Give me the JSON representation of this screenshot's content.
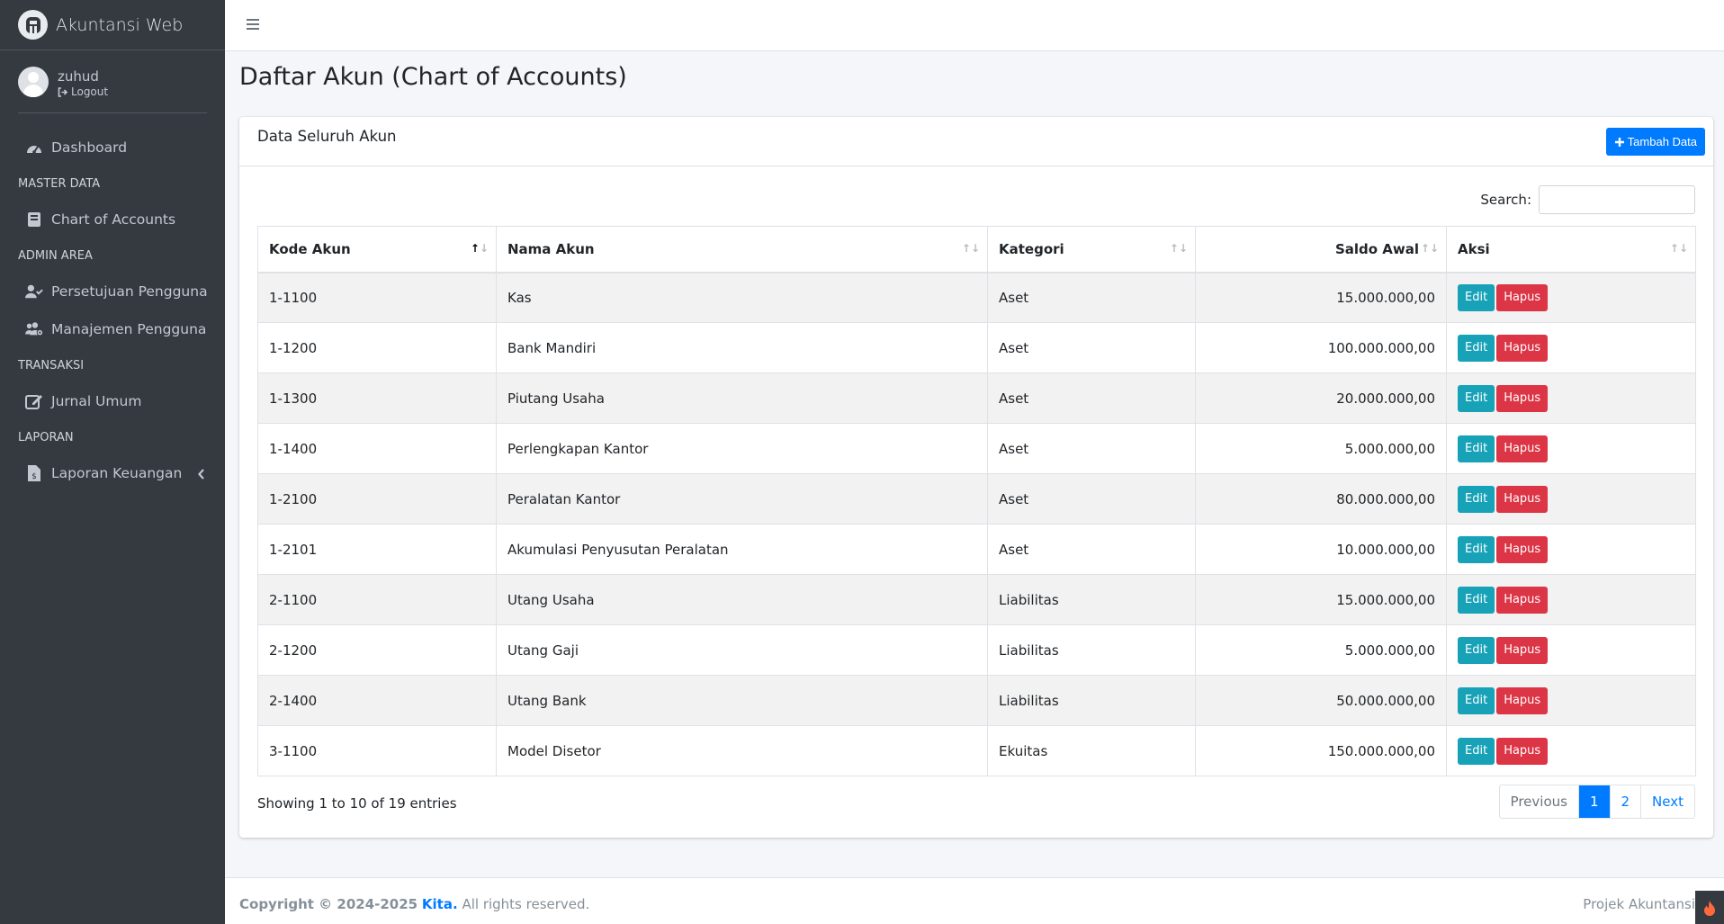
{
  "brand": {
    "name": "Akuntansi Web"
  },
  "user": {
    "name": "zuhud",
    "logout_label": "Logout"
  },
  "sidebar": {
    "dashboard": "Dashboard",
    "header_master": "MASTER DATA",
    "coa": "Chart of Accounts",
    "header_admin": "ADMIN AREA",
    "persetujuan": "Persetujuan Pengguna",
    "manajemen": "Manajemen Pengguna",
    "header_transaksi": "TRANSAKSI",
    "jurnal": "Jurnal Umum",
    "header_laporan": "LAPORAN",
    "laporan": "Laporan Keuangan"
  },
  "page": {
    "title": "Daftar Akun (Chart of Accounts)"
  },
  "card": {
    "title": "Data Seluruh Akun",
    "add_button": "Tambah Data"
  },
  "search": {
    "label": "Search:",
    "value": ""
  },
  "table": {
    "headers": [
      "Kode Akun",
      "Nama Akun",
      "Kategori",
      "Saldo Awal",
      "Aksi"
    ],
    "rows": [
      {
        "kode": "1-1100",
        "nama": "Kas",
        "kategori": "Aset",
        "saldo": "15.000.000,00"
      },
      {
        "kode": "1-1200",
        "nama": "Bank Mandiri",
        "kategori": "Aset",
        "saldo": "100.000.000,00"
      },
      {
        "kode": "1-1300",
        "nama": "Piutang Usaha",
        "kategori": "Aset",
        "saldo": "20.000.000,00"
      },
      {
        "kode": "1-1400",
        "nama": "Perlengkapan Kantor",
        "kategori": "Aset",
        "saldo": "5.000.000,00"
      },
      {
        "kode": "1-2100",
        "nama": "Peralatan Kantor",
        "kategori": "Aset",
        "saldo": "80.000.000,00"
      },
      {
        "kode": "1-2101",
        "nama": "Akumulasi Penyusutan Peralatan",
        "kategori": "Aset",
        "saldo": "10.000.000,00"
      },
      {
        "kode": "2-1100",
        "nama": "Utang Usaha",
        "kategori": "Liabilitas",
        "saldo": "15.000.000,00"
      },
      {
        "kode": "2-1200",
        "nama": "Utang Gaji",
        "kategori": "Liabilitas",
        "saldo": "5.000.000,00"
      },
      {
        "kode": "2-1400",
        "nama": "Utang Bank",
        "kategori": "Liabilitas",
        "saldo": "50.000.000,00"
      },
      {
        "kode": "3-1100",
        "nama": "Model Disetor",
        "kategori": "Ekuitas",
        "saldo": "150.000.000,00"
      }
    ],
    "edit_label": "Edit",
    "delete_label": "Hapus"
  },
  "info": "Showing 1 to 10 of 19 entries",
  "pagination": {
    "previous": "Previous",
    "pages": [
      "1",
      "2"
    ],
    "next": "Next"
  },
  "footer": {
    "copyright_prefix": "Copyright © 2024-2025",
    "company": "Kita.",
    "rights": "All rights reserved.",
    "right_text": "Projek Akuntansi"
  },
  "colors": {
    "primary": "#007bff",
    "info": "#17a2b8",
    "danger": "#dc3545",
    "sidebar": "#343a40"
  }
}
